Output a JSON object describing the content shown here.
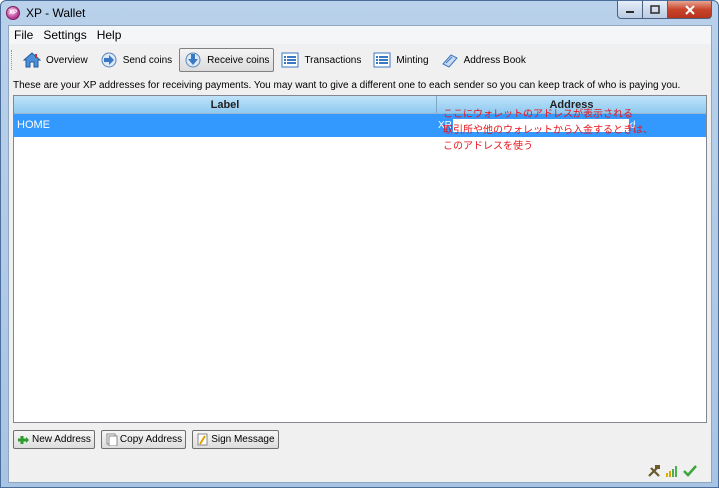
{
  "window": {
    "title": "XP - Wallet",
    "app_icon_text": "XP"
  },
  "menu": [
    "File",
    "Settings",
    "Help"
  ],
  "toolbar": {
    "overview": "Overview",
    "send": "Send coins",
    "receive": "Receive coins",
    "transactions": "Transactions",
    "minting": "Minting",
    "address_book": "Address Book"
  },
  "info_text": "These are your XP addresses for receiving payments. You may want to give a different one to each sender so you can keep track of who is paying you.",
  "table": {
    "headers": {
      "label": "Label",
      "address": "Address"
    },
    "rows": [
      {
        "label": "HOME",
        "address_prefix": "XR",
        "address_suffix": "d"
      }
    ]
  },
  "annotation": [
    "ここにウォレットのアドレスが表示される",
    "取引所や他のウォレットから入金するときは、",
    "このアドレスを使う"
  ],
  "buttons": {
    "new_address": "New Address",
    "copy_address": "Copy Address",
    "sign_message": "Sign Message"
  },
  "status_icons": [
    "tools-icon",
    "signal-icon",
    "checkmark-icon"
  ],
  "colors": {
    "selection": "#3399ff",
    "annotation": "#e8141c",
    "header": "#9fd3f4"
  }
}
